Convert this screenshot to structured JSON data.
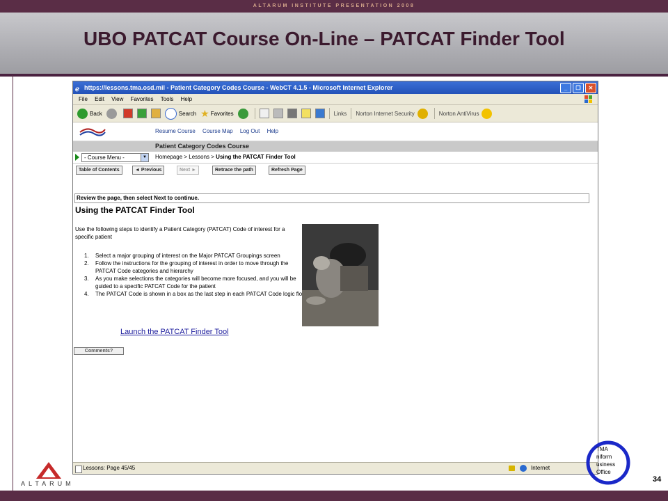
{
  "slide": {
    "header_text": "ALTARUM INSTITUTE PRESENTATION 2008",
    "title": "UBO PATCAT Course On-Line – PATCAT Finder Tool",
    "page_number": "34",
    "logo_text": "ALTARUM",
    "tma_lines": [
      "TMA",
      "niform",
      "usiness",
      "Office"
    ]
  },
  "browser": {
    "window_title": "https://lessons.tma.osd.mil - Patient Category Codes Course - WebCT 4.1.5 - Microsoft Internet Explorer",
    "menu": [
      "File",
      "Edit",
      "View",
      "Favorites",
      "Tools",
      "Help"
    ],
    "toolbar": {
      "back": "Back",
      "search": "Search",
      "favorites": "Favorites",
      "links": "Links",
      "norton_security": "Norton Internet Security",
      "norton_antivirus": "Norton AntiVirus"
    },
    "status": {
      "left": "Lessons: Page 45/45",
      "zone": "Internet"
    }
  },
  "webct": {
    "nav_links": [
      "Resume Course",
      "Course Map",
      "Log Out",
      "Help"
    ],
    "course_title": "Patient Category Codes Course",
    "course_menu": "- Course Menu -",
    "breadcrumb": {
      "path": "Homepage > Lessons > ",
      "current": "Using the PATCAT Finder Tool"
    },
    "buttons": {
      "toc": "Table of Contents",
      "previous": "◄ Previous",
      "next": "Next ►",
      "retrace": "Retrace the path",
      "refresh": "Refresh Page"
    }
  },
  "content": {
    "instruction": "Review the page, then select Next to continue.",
    "title": "Using the PATCAT Finder Tool",
    "intro": "Use the following steps to identify a Patient Category (PATCAT) Code of interest for a specific patient",
    "steps": [
      "Select a major grouping of interest on the Major PATCAT Groupings screen",
      "Follow the instructions for the grouping of interest in order to move through the PATCAT Code categories and hierarchy",
      "As you make selections the categories will become more focused, and you will be guided to a specific PATCAT Code for the patient",
      "The PATCAT Code is shown in a box as the last step in each PATCAT Code logic flow"
    ],
    "launch_link": "Launch the PATCAT Finder Tool",
    "comments_button": "Comments?"
  }
}
